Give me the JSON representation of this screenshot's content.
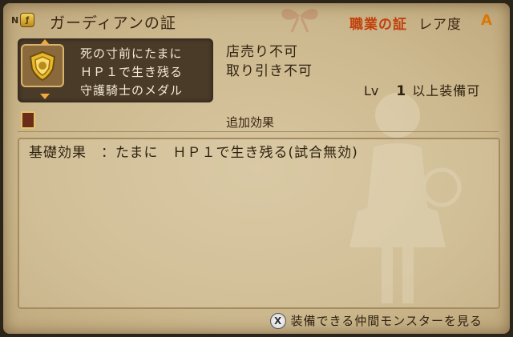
{
  "header": {
    "rank_letter": "N",
    "title": "ガーディアンの証",
    "category": "職業の証",
    "rarity_label": "レア度",
    "rarity_value": "A"
  },
  "item": {
    "icon": "shield-medal-icon",
    "description": "死の寸前にたまに\nＨＰ１で生き残る\n守護騎士のメダル"
  },
  "restrictions": {
    "sell": "店売り不可",
    "trade": "取り引き不可"
  },
  "level": {
    "label": "Lv",
    "value": "1",
    "text": "以上装備可"
  },
  "effects": {
    "header": "追加効果",
    "lines": [
      "基礎効果　：たまに　ＨＰ１で生き残る(試合無効)"
    ]
  },
  "footer": {
    "button": "X",
    "text": "装備できる仲間モンスターを見る"
  },
  "colors": {
    "category": "#c2410c",
    "rarity": "#d97706",
    "panel": "#cdb98f"
  }
}
